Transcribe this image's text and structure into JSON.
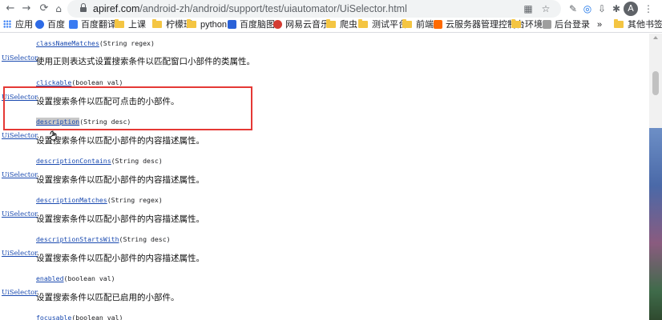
{
  "browser": {
    "url_host": "apiref.com",
    "url_path": "/android-zh/android/support/test/uiautomator/UiSelector.html",
    "avatar_letter": "A",
    "bookmarks": [
      {
        "label": "应用",
        "icon": "apps-grid-icon"
      },
      {
        "label": "百度",
        "icon": "baidu-icon"
      },
      {
        "label": "百度翻译",
        "icon": "baidu-translate-icon"
      },
      {
        "label": "上课",
        "icon": "folder-icon"
      },
      {
        "label": "柠檬班",
        "icon": "folder-icon"
      },
      {
        "label": "python",
        "icon": "folder-icon"
      },
      {
        "label": "百度脑图",
        "icon": "baidu-naotu-icon"
      },
      {
        "label": "网易云音乐",
        "icon": "netease-music-icon"
      },
      {
        "label": "爬虫",
        "icon": "folder-icon"
      },
      {
        "label": "测试平台",
        "icon": "folder-icon"
      },
      {
        "label": "前端",
        "icon": "folder-icon"
      },
      {
        "label": "云服务器管理控制台",
        "icon": "aliyun-icon"
      },
      {
        "label": "环境",
        "icon": "folder-icon"
      },
      {
        "label": "后台登录",
        "icon": "image-icon"
      },
      {
        "label": "»",
        "icon": ""
      },
      {
        "label": "其他书签",
        "icon": "folder-icon"
      }
    ]
  },
  "methods": [
    {
      "return_type": "",
      "name": "classNameMatches",
      "params": "(String regex)",
      "description": ""
    },
    {
      "return_type": "UiSelector",
      "name": "",
      "params": "",
      "description": "使用正则表达式设置搜索条件以匹配窗口小部件的类属性。"
    },
    {
      "return_type": "",
      "name": "clickable",
      "params": "(boolean val)",
      "description": ""
    },
    {
      "return_type": "UiSelector",
      "name": "",
      "params": "",
      "description": "设置搜索条件以匹配可点击的小部件。"
    },
    {
      "return_type": "",
      "name": "description",
      "params": "(String desc)",
      "description": ""
    },
    {
      "return_type": "UiSelector",
      "name": "",
      "params": "",
      "description": "设置搜索条件以匹配小部件的内容描述属性。"
    },
    {
      "return_type": "",
      "name": "descriptionContains",
      "params": "(String desc)",
      "description": ""
    },
    {
      "return_type": "UiSelector",
      "name": "",
      "params": "",
      "description": "设置搜索条件以匹配小部件的内容描述属性。"
    },
    {
      "return_type": "",
      "name": "descriptionMatches",
      "params": "(String regex)",
      "description": ""
    },
    {
      "return_type": "UiSelector",
      "name": "",
      "params": "",
      "description": "设置搜索条件以匹配小部件的内容描述属性。"
    },
    {
      "return_type": "",
      "name": "descriptionStartsWith",
      "params": "(String desc)",
      "description": ""
    },
    {
      "return_type": "UiSelector",
      "name": "",
      "params": "",
      "description": "设置搜索条件以匹配小部件的内容描述属性。"
    },
    {
      "return_type": "",
      "name": "enabled",
      "params": "(boolean val)",
      "description": ""
    },
    {
      "return_type": "UiSelector",
      "name": "",
      "params": "",
      "description": "设置搜索条件以匹配已启用的小部件。"
    },
    {
      "return_type": "",
      "name": "focusable",
      "params": "(boolean val)",
      "description": ""
    }
  ],
  "colors": {
    "annotation_box": "#e53935",
    "link": "#1a4ab0"
  }
}
